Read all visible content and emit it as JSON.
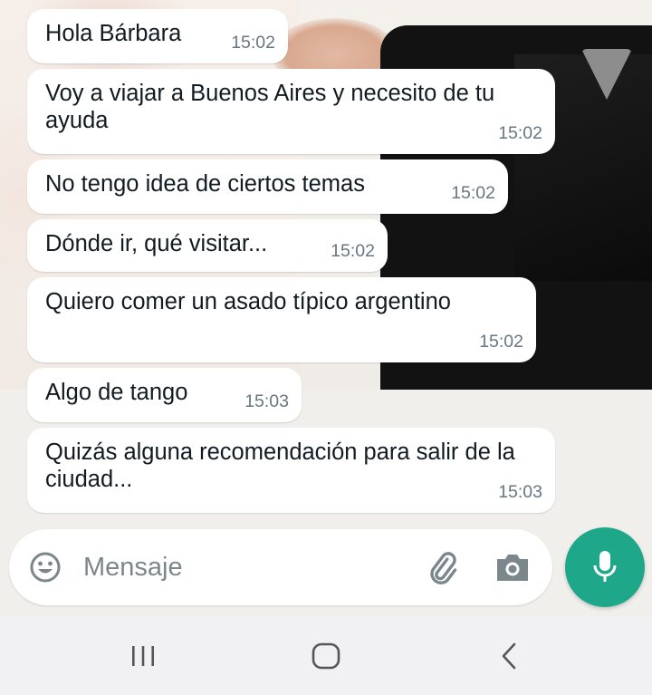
{
  "messages": [
    {
      "text": "Hola Bárbara",
      "time": "15:02"
    },
    {
      "text": "Voy a viajar a Buenos Aires y necesito de tu ayuda",
      "time": "15:02"
    },
    {
      "text": "No tengo idea de ciertos temas",
      "time": "15:02"
    },
    {
      "text": "Dónde ir, qué visitar...",
      "time": "15:02"
    },
    {
      "text": "Quiero comer un asado típico argentino",
      "time": "15:02"
    },
    {
      "text": "Algo de tango",
      "time": "15:03"
    },
    {
      "text": "Quizás alguna recomendación para salir de la ciudad...",
      "time": "15:03"
    }
  ],
  "composer": {
    "placeholder": "Mensaje",
    "icons": {
      "emoji": "emoji-icon",
      "attach": "paperclip-icon",
      "camera": "camera-icon",
      "send": "microphone-icon"
    }
  },
  "nav_bar": {
    "icons": {
      "recents": "recent-apps-icon",
      "home": "home-icon",
      "back": "back-icon"
    }
  },
  "colors": {
    "bubble": "#ffffff",
    "text": "#111b21",
    "timestamp": "#667781",
    "mic_button": "#1fa78a",
    "icon_gray": "#7c878c",
    "nav_bar": "#f1f1f3"
  }
}
